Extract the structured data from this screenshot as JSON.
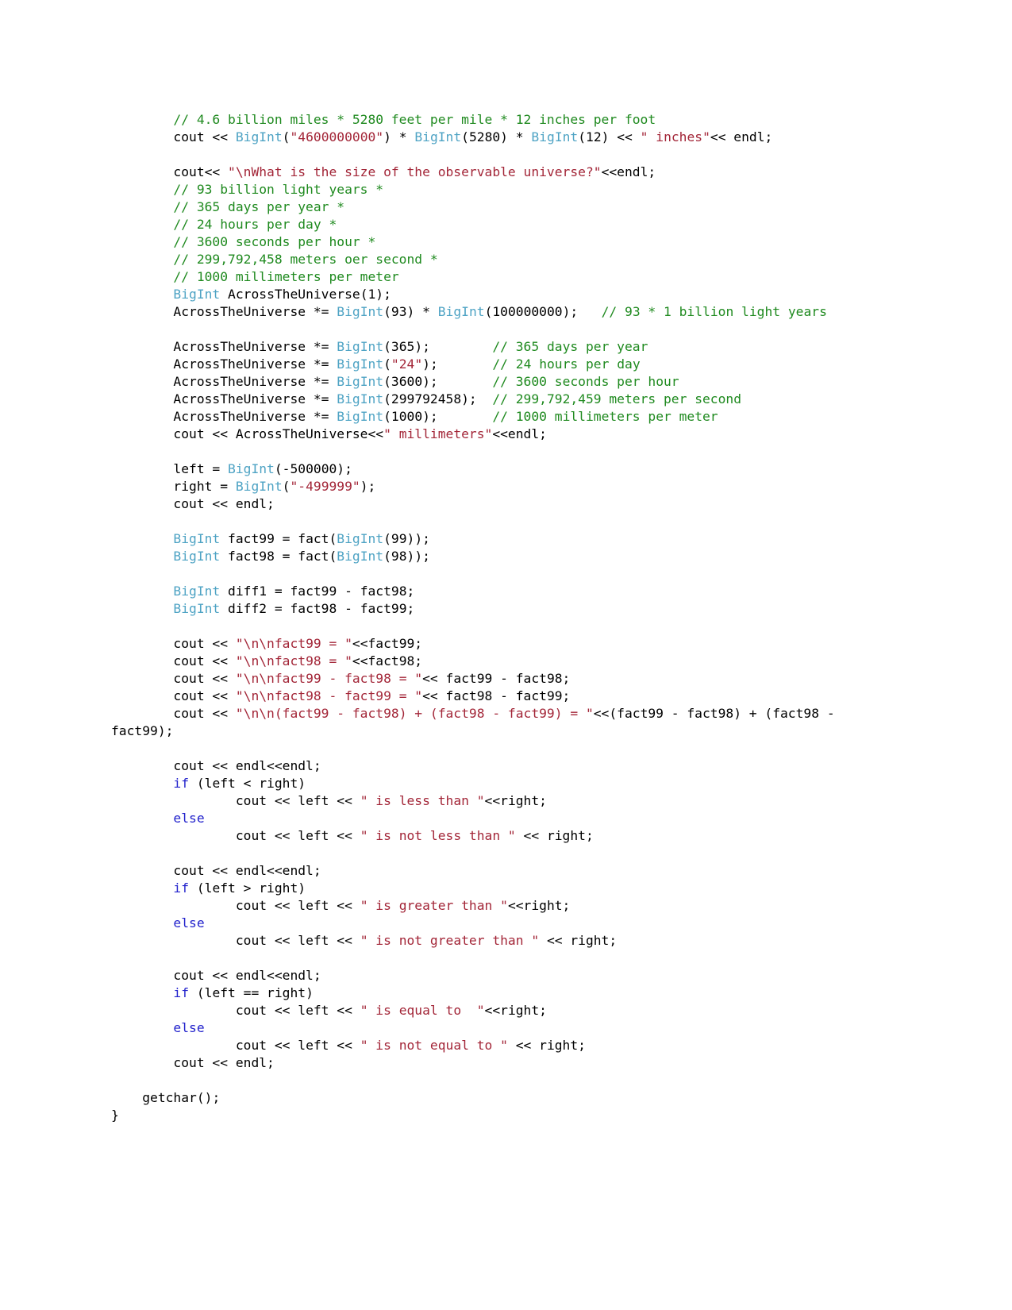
{
  "document": {
    "kind": "source-code-listing",
    "language": "C++",
    "background_color": "#ffffff",
    "colors": {
      "comment": "#1f8a1f",
      "string": "#a32638",
      "type": "#4ea3c4",
      "keyword": "#2222cc",
      "plain": "#000000"
    }
  },
  "code": {
    "lines": [
      {
        "id": "l01",
        "text": "        // 4.6 billion miles * 5280 feet per mile * 12 inches per foot",
        "tokens": [
          {
            "t": "comment",
            "v": "        // 4.6 billion miles * 5280 feet per mile * 12 inches per foot"
          }
        ]
      },
      {
        "id": "l02",
        "text": "        cout << BigInt(\"4600000000\") * BigInt(5280) * BigInt(12) << \" inches\"<< endl;",
        "tokens": [
          {
            "t": "plain",
            "v": "        cout << "
          },
          {
            "t": "type",
            "v": "BigInt"
          },
          {
            "t": "plain",
            "v": "("
          },
          {
            "t": "string",
            "v": "\"4600000000\""
          },
          {
            "t": "plain",
            "v": ") * "
          },
          {
            "t": "type",
            "v": "BigInt"
          },
          {
            "t": "plain",
            "v": "(5280) * "
          },
          {
            "t": "type",
            "v": "BigInt"
          },
          {
            "t": "plain",
            "v": "(12) << "
          },
          {
            "t": "string",
            "v": "\" inches\""
          },
          {
            "t": "plain",
            "v": "<< endl;"
          }
        ]
      },
      {
        "id": "l03",
        "text": "",
        "tokens": []
      },
      {
        "id": "l04",
        "text": "        cout<< \"\\nWhat is the size of the observable universe?\"<<endl;",
        "tokens": [
          {
            "t": "plain",
            "v": "        cout<< "
          },
          {
            "t": "string",
            "v": "\"\\nWhat is the size of the observable universe?\""
          },
          {
            "t": "plain",
            "v": "<<endl;"
          }
        ]
      },
      {
        "id": "l05",
        "text": "        // 93 billion light years *",
        "tokens": [
          {
            "t": "comment",
            "v": "        // 93 billion light years *"
          }
        ]
      },
      {
        "id": "l06",
        "text": "        // 365 days per year *",
        "tokens": [
          {
            "t": "comment",
            "v": "        // 365 days per year *"
          }
        ]
      },
      {
        "id": "l07",
        "text": "        // 24 hours per day *",
        "tokens": [
          {
            "t": "comment",
            "v": "        // 24 hours per day *"
          }
        ]
      },
      {
        "id": "l08",
        "text": "        // 3600 seconds per hour *",
        "tokens": [
          {
            "t": "comment",
            "v": "        // 3600 seconds per hour *"
          }
        ]
      },
      {
        "id": "l09",
        "text": "        // 299,792,458 meters oer second *",
        "tokens": [
          {
            "t": "comment",
            "v": "        // 299,792,458 meters oer second *"
          }
        ]
      },
      {
        "id": "l10",
        "text": "        // 1000 millimeters per meter",
        "tokens": [
          {
            "t": "comment",
            "v": "        // 1000 millimeters per meter"
          }
        ]
      },
      {
        "id": "l11",
        "text": "        BigInt AcrossTheUniverse(1);",
        "tokens": [
          {
            "t": "plain",
            "v": "        "
          },
          {
            "t": "type",
            "v": "BigInt"
          },
          {
            "t": "plain",
            "v": " AcrossTheUniverse(1);"
          }
        ]
      },
      {
        "id": "l12",
        "text": "        AcrossTheUniverse *= BigInt(93) * BigInt(100000000);   // 93 * 1 billion light years",
        "tokens": [
          {
            "t": "plain",
            "v": "        AcrossTheUniverse *= "
          },
          {
            "t": "type",
            "v": "BigInt"
          },
          {
            "t": "plain",
            "v": "(93) * "
          },
          {
            "t": "type",
            "v": "BigInt"
          },
          {
            "t": "plain",
            "v": "(100000000);   "
          },
          {
            "t": "comment",
            "v": "// 93 * 1 billion light years"
          }
        ]
      },
      {
        "id": "l13",
        "text": "",
        "tokens": []
      },
      {
        "id": "l14",
        "text": "        AcrossTheUniverse *= BigInt(365);        // 365 days per year",
        "tokens": [
          {
            "t": "plain",
            "v": "        AcrossTheUniverse *= "
          },
          {
            "t": "type",
            "v": "BigInt"
          },
          {
            "t": "plain",
            "v": "(365);        "
          },
          {
            "t": "comment",
            "v": "// 365 days per year"
          }
        ]
      },
      {
        "id": "l15",
        "text": "        AcrossTheUniverse *= BigInt(\"24\");       // 24 hours per day",
        "tokens": [
          {
            "t": "plain",
            "v": "        AcrossTheUniverse *= "
          },
          {
            "t": "type",
            "v": "BigInt"
          },
          {
            "t": "plain",
            "v": "("
          },
          {
            "t": "string",
            "v": "\"24\""
          },
          {
            "t": "plain",
            "v": ");       "
          },
          {
            "t": "comment",
            "v": "// 24 hours per day"
          }
        ]
      },
      {
        "id": "l16",
        "text": "        AcrossTheUniverse *= BigInt(3600);       // 3600 seconds per hour",
        "tokens": [
          {
            "t": "plain",
            "v": "        AcrossTheUniverse *= "
          },
          {
            "t": "type",
            "v": "BigInt"
          },
          {
            "t": "plain",
            "v": "(3600);       "
          },
          {
            "t": "comment",
            "v": "// 3600 seconds per hour"
          }
        ]
      },
      {
        "id": "l17",
        "text": "        AcrossTheUniverse *= BigInt(299792458);  // 299,792,459 meters per second",
        "tokens": [
          {
            "t": "plain",
            "v": "        AcrossTheUniverse *= "
          },
          {
            "t": "type",
            "v": "BigInt"
          },
          {
            "t": "plain",
            "v": "(299792458);  "
          },
          {
            "t": "comment",
            "v": "// 299,792,459 meters per second"
          }
        ]
      },
      {
        "id": "l18",
        "text": "        AcrossTheUniverse *= BigInt(1000);       // 1000 millimeters per meter",
        "tokens": [
          {
            "t": "plain",
            "v": "        AcrossTheUniverse *= "
          },
          {
            "t": "type",
            "v": "BigInt"
          },
          {
            "t": "plain",
            "v": "(1000);       "
          },
          {
            "t": "comment",
            "v": "// 1000 millimeters per meter"
          }
        ]
      },
      {
        "id": "l19",
        "text": "        cout << AcrossTheUniverse<<\" millimeters\"<<endl;",
        "tokens": [
          {
            "t": "plain",
            "v": "        cout << AcrossTheUniverse<<"
          },
          {
            "t": "string",
            "v": "\" millimeters\""
          },
          {
            "t": "plain",
            "v": "<<endl;"
          }
        ]
      },
      {
        "id": "l20",
        "text": "",
        "tokens": []
      },
      {
        "id": "l21",
        "text": "        left = BigInt(-500000);",
        "tokens": [
          {
            "t": "plain",
            "v": "        left = "
          },
          {
            "t": "type",
            "v": "BigInt"
          },
          {
            "t": "plain",
            "v": "(-500000);"
          }
        ]
      },
      {
        "id": "l22",
        "text": "        right = BigInt(\"-499999\");",
        "tokens": [
          {
            "t": "plain",
            "v": "        right = "
          },
          {
            "t": "type",
            "v": "BigInt"
          },
          {
            "t": "plain",
            "v": "("
          },
          {
            "t": "string",
            "v": "\"-499999\""
          },
          {
            "t": "plain",
            "v": ");"
          }
        ]
      },
      {
        "id": "l23",
        "text": "        cout << endl;",
        "tokens": [
          {
            "t": "plain",
            "v": "        cout << endl;"
          }
        ]
      },
      {
        "id": "l24",
        "text": "",
        "tokens": []
      },
      {
        "id": "l25",
        "text": "        BigInt fact99 = fact(BigInt(99));",
        "tokens": [
          {
            "t": "plain",
            "v": "        "
          },
          {
            "t": "type",
            "v": "BigInt"
          },
          {
            "t": "plain",
            "v": " fact99 = fact("
          },
          {
            "t": "type",
            "v": "BigInt"
          },
          {
            "t": "plain",
            "v": "(99));"
          }
        ]
      },
      {
        "id": "l26",
        "text": "        BigInt fact98 = fact(BigInt(98));",
        "tokens": [
          {
            "t": "plain",
            "v": "        "
          },
          {
            "t": "type",
            "v": "BigInt"
          },
          {
            "t": "plain",
            "v": " fact98 = fact("
          },
          {
            "t": "type",
            "v": "BigInt"
          },
          {
            "t": "plain",
            "v": "(98));"
          }
        ]
      },
      {
        "id": "l27",
        "text": "",
        "tokens": []
      },
      {
        "id": "l28",
        "text": "        BigInt diff1 = fact99 - fact98;",
        "tokens": [
          {
            "t": "plain",
            "v": "        "
          },
          {
            "t": "type",
            "v": "BigInt"
          },
          {
            "t": "plain",
            "v": " diff1 = fact99 - fact98;"
          }
        ]
      },
      {
        "id": "l29",
        "text": "        BigInt diff2 = fact98 - fact99;",
        "tokens": [
          {
            "t": "plain",
            "v": "        "
          },
          {
            "t": "type",
            "v": "BigInt"
          },
          {
            "t": "plain",
            "v": " diff2 = fact98 - fact99;"
          }
        ]
      },
      {
        "id": "l30",
        "text": "",
        "tokens": []
      },
      {
        "id": "l31",
        "text": "        cout << \"\\n\\nfact99 = \"<<fact99;",
        "tokens": [
          {
            "t": "plain",
            "v": "        cout << "
          },
          {
            "t": "string",
            "v": "\"\\n\\nfact99 = \""
          },
          {
            "t": "plain",
            "v": "<<fact99;"
          }
        ]
      },
      {
        "id": "l32",
        "text": "        cout << \"\\n\\nfact98 = \"<<fact98;",
        "tokens": [
          {
            "t": "plain",
            "v": "        cout << "
          },
          {
            "t": "string",
            "v": "\"\\n\\nfact98 = \""
          },
          {
            "t": "plain",
            "v": "<<fact98;"
          }
        ]
      },
      {
        "id": "l33",
        "text": "        cout << \"\\n\\nfact99 - fact98 = \"<< fact99 - fact98;",
        "tokens": [
          {
            "t": "plain",
            "v": "        cout << "
          },
          {
            "t": "string",
            "v": "\"\\n\\nfact99 - fact98 = \""
          },
          {
            "t": "plain",
            "v": "<< fact99 - fact98;"
          }
        ]
      },
      {
        "id": "l34",
        "text": "        cout << \"\\n\\nfact98 - fact99 = \"<< fact98 - fact99;",
        "tokens": [
          {
            "t": "plain",
            "v": "        cout << "
          },
          {
            "t": "string",
            "v": "\"\\n\\nfact98 - fact99 = \""
          },
          {
            "t": "plain",
            "v": "<< fact98 - fact99;"
          }
        ]
      },
      {
        "id": "l35",
        "text": "        cout << \"\\n\\n(fact99 - fact98) + (fact98 - fact99) = \"<<(fact99 - fact98) + (fact98 - fact99);",
        "tokens": [
          {
            "t": "plain",
            "v": "        cout << "
          },
          {
            "t": "string",
            "v": "\"\\n\\n(fact99 - fact98) + (fact98 - fact99) = \""
          },
          {
            "t": "plain",
            "v": "<<(fact99 - fact98) + (fact98 - fact99);"
          }
        ]
      },
      {
        "id": "l36",
        "text": "",
        "tokens": []
      },
      {
        "id": "l37",
        "text": "        cout << endl<<endl;",
        "tokens": [
          {
            "t": "plain",
            "v": "        cout << endl<<endl;"
          }
        ]
      },
      {
        "id": "l38",
        "text": "        if (left < right)",
        "tokens": [
          {
            "t": "plain",
            "v": "        "
          },
          {
            "t": "kw",
            "v": "if"
          },
          {
            "t": "plain",
            "v": " (left < right)"
          }
        ]
      },
      {
        "id": "l39",
        "text": "                cout << left << \" is less than \"<<right;",
        "tokens": [
          {
            "t": "plain",
            "v": "                cout << left << "
          },
          {
            "t": "string",
            "v": "\" is less than \""
          },
          {
            "t": "plain",
            "v": "<<right;"
          }
        ]
      },
      {
        "id": "l40",
        "text": "        else",
        "tokens": [
          {
            "t": "plain",
            "v": "        "
          },
          {
            "t": "kw",
            "v": "else"
          }
        ]
      },
      {
        "id": "l41",
        "text": "                cout << left << \" is not less than \" << right;",
        "tokens": [
          {
            "t": "plain",
            "v": "                cout << left << "
          },
          {
            "t": "string",
            "v": "\" is not less than \""
          },
          {
            "t": "plain",
            "v": " << right;"
          }
        ]
      },
      {
        "id": "l42",
        "text": "",
        "tokens": []
      },
      {
        "id": "l43",
        "text": "        cout << endl<<endl;",
        "tokens": [
          {
            "t": "plain",
            "v": "        cout << endl<<endl;"
          }
        ]
      },
      {
        "id": "l44",
        "text": "        if (left > right)",
        "tokens": [
          {
            "t": "plain",
            "v": "        "
          },
          {
            "t": "kw",
            "v": "if"
          },
          {
            "t": "plain",
            "v": " (left > right)"
          }
        ]
      },
      {
        "id": "l45",
        "text": "                cout << left << \" is greater than \"<<right;",
        "tokens": [
          {
            "t": "plain",
            "v": "                cout << left << "
          },
          {
            "t": "string",
            "v": "\" is greater than \""
          },
          {
            "t": "plain",
            "v": "<<right;"
          }
        ]
      },
      {
        "id": "l46",
        "text": "        else",
        "tokens": [
          {
            "t": "plain",
            "v": "        "
          },
          {
            "t": "kw",
            "v": "else"
          }
        ]
      },
      {
        "id": "l47",
        "text": "                cout << left << \" is not greater than \" << right;",
        "tokens": [
          {
            "t": "plain",
            "v": "                cout << left << "
          },
          {
            "t": "string",
            "v": "\" is not greater than \""
          },
          {
            "t": "plain",
            "v": " << right;"
          }
        ]
      },
      {
        "id": "l48",
        "text": "",
        "tokens": []
      },
      {
        "id": "l49",
        "text": "        cout << endl<<endl;",
        "tokens": [
          {
            "t": "plain",
            "v": "        cout << endl<<endl;"
          }
        ]
      },
      {
        "id": "l50",
        "text": "        if (left == right)",
        "tokens": [
          {
            "t": "plain",
            "v": "        "
          },
          {
            "t": "kw",
            "v": "if"
          },
          {
            "t": "plain",
            "v": " (left == right)"
          }
        ]
      },
      {
        "id": "l51",
        "text": "                cout << left << \" is equal to  \"<<right;",
        "tokens": [
          {
            "t": "plain",
            "v": "                cout << left << "
          },
          {
            "t": "string",
            "v": "\" is equal to  \""
          },
          {
            "t": "plain",
            "v": "<<right;"
          }
        ]
      },
      {
        "id": "l52",
        "text": "        else",
        "tokens": [
          {
            "t": "plain",
            "v": "        "
          },
          {
            "t": "kw",
            "v": "else"
          }
        ]
      },
      {
        "id": "l53",
        "text": "                cout << left << \" is not equal to \" << right;",
        "tokens": [
          {
            "t": "plain",
            "v": "                cout << left << "
          },
          {
            "t": "string",
            "v": "\" is not equal to \""
          },
          {
            "t": "plain",
            "v": " << right;"
          }
        ]
      },
      {
        "id": "l54",
        "text": "        cout << endl;",
        "tokens": [
          {
            "t": "plain",
            "v": "        cout << endl;"
          }
        ]
      },
      {
        "id": "l55",
        "text": "",
        "tokens": []
      },
      {
        "id": "l56",
        "text": "    getchar();",
        "tokens": [
          {
            "t": "plain",
            "v": "    getchar();"
          }
        ]
      },
      {
        "id": "l57",
        "text": "}",
        "tokens": [
          {
            "t": "plain",
            "v": "}"
          }
        ]
      }
    ]
  }
}
